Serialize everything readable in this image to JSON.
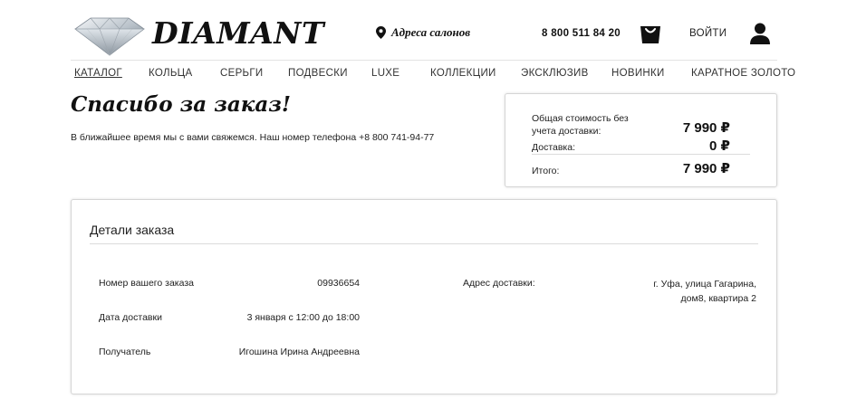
{
  "header": {
    "logo_text": "DIAMANT",
    "salons_label": "Адреса салонов",
    "phone": "8 800 511 84 20",
    "login_label": "ВОЙТИ"
  },
  "nav": {
    "items": [
      {
        "label": "КАТАЛОГ",
        "active": true
      },
      {
        "label": "КОЛЬЦА"
      },
      {
        "label": "СЕРЬГИ"
      },
      {
        "label": "ПОДВЕСКИ"
      },
      {
        "label": "LUXE"
      },
      {
        "label": "КОЛЛЕКЦИИ"
      },
      {
        "label": "ЭКСКЛЮЗИВ"
      },
      {
        "label": "НОВИНКИ"
      },
      {
        "label": "КАРАТНОЕ ЗОЛОТО"
      }
    ]
  },
  "thanks": {
    "title": "Спасибо за заказ!",
    "text": "В ближайшее время мы с вами свяжемся. Наш номер телефона +8 800 741-94-77"
  },
  "summary": {
    "subtotal_label_line1": "Общая стоимость без",
    "subtotal_label_line2": "учета доставки:",
    "subtotal_value": "7 990 ₽",
    "delivery_label": "Доставка:",
    "delivery_value": "0 ₽",
    "total_label": "Итого:",
    "total_value": "7 990 ₽"
  },
  "details": {
    "title": "Детали заказа",
    "order_number_label": "Номер вашего заказа",
    "order_number_value": "09936654",
    "delivery_date_label": "Дата доставки",
    "delivery_date_value": "3 января с 12:00 до 18:00",
    "recipient_label": "Получатель",
    "recipient_value": "Игошина Ирина Андреевна",
    "address_label": "Адрес доставки:",
    "address_line1": "г. Уфа, улица Гагарина,",
    "address_line2": "дом8, квартира 2"
  },
  "icons": {
    "logo": "diamond-icon",
    "salons": "map-pin-icon",
    "cart": "shopping-bag-icon",
    "user": "user-icon"
  }
}
